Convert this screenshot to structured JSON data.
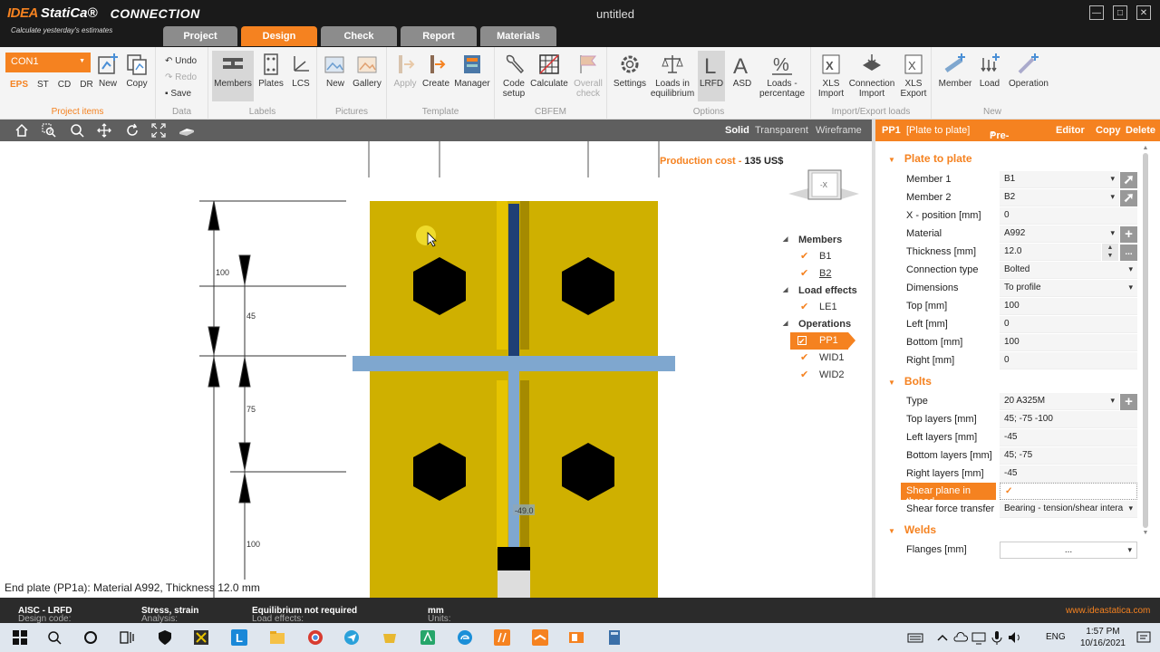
{
  "app": {
    "brand_idea": "IDEA",
    "brand_statica": "StatiCa®",
    "product": "CONNECTION",
    "tagline": "Calculate yesterday's estimates",
    "window_title": "untitled",
    "minimize": "—",
    "maximize": "□",
    "close": "✕"
  },
  "tabs": [
    {
      "label": "Project"
    },
    {
      "label": "Design"
    },
    {
      "label": "Check"
    },
    {
      "label": "Report"
    },
    {
      "label": "Materials"
    }
  ],
  "ribbon": {
    "connection_select": "CON1",
    "codes": [
      "EPS",
      "ST",
      "CD",
      "DR"
    ],
    "new_label": "New",
    "copy_label": "Copy",
    "project_items_label": "Project items",
    "undo": "Undo",
    "redo": "Redo",
    "save": "Save",
    "data_label": "Data",
    "members": "Members",
    "plates": "Plates",
    "lcs": "LCS",
    "labels_label": "Labels",
    "pic_new": "New",
    "gallery": "Gallery",
    "pictures_label": "Pictures",
    "apply": "Apply",
    "create": "Create",
    "manager": "Manager",
    "template_label": "Template",
    "code_setup": "Code\nsetup",
    "calculate": "Calculate",
    "overall_check": "Overall\ncheck",
    "cbfem_label": "CBFEM",
    "settings": "Settings",
    "loads_eq": "Loads in\nequilibrium",
    "lrfd": "LRFD",
    "asd": "ASD",
    "loads_pct": "Loads -\npercentage",
    "options_label": "Options",
    "xls_import": "XLS\nImport",
    "conn_import": "Connection\nImport",
    "xls_export": "XLS\nExport",
    "ie_label": "Import/Export loads",
    "member": "Member",
    "load": "Load",
    "operation": "Operation",
    "new_group_label": "New"
  },
  "toolbar": {
    "solid": "Solid",
    "transparent": "Transparent",
    "wireframe": "Wireframe"
  },
  "viewport": {
    "production_cost_label": "Production cost",
    "production_cost_sep": "-",
    "production_cost_value": "135 US$",
    "cube_label": "-X",
    "dims": [
      "100",
      "45",
      "75",
      "100"
    ],
    "weld_tag": "-49.0",
    "status": "End plate (PP1a): Material A992, Thickness 12.0 mm"
  },
  "tree": {
    "members_label": "Members",
    "members": [
      "B1",
      "B2"
    ],
    "loads_label": "Load effects",
    "loads": [
      "LE1"
    ],
    "ops_label": "Operations",
    "ops": [
      "PP1",
      "WID1",
      "WID2"
    ]
  },
  "panel_header": {
    "id": "PP1",
    "name": "[Plate to plate]",
    "predesign": "Pre-design",
    "editor": "Editor",
    "copy": "Copy",
    "delete": "Delete"
  },
  "props": {
    "sec_plate": "Plate to plate",
    "member1_label": "Member 1",
    "member1": "B1",
    "member2_label": "Member 2",
    "member2": "B2",
    "xpos_label": "X - position [mm]",
    "xpos": "0",
    "material_label": "Material",
    "material": "A992",
    "thickness_label": "Thickness [mm]",
    "thickness": "12.0",
    "conntype_label": "Connection type",
    "conntype": "Bolted",
    "dimensions_label": "Dimensions",
    "dimensions": "To profile",
    "top_label": "Top [mm]",
    "top": "100",
    "left_label": "Left [mm]",
    "left": "0",
    "bottom_label": "Bottom [mm]",
    "bottom": "100",
    "right_label": "Right [mm]",
    "right": "0",
    "sec_bolts": "Bolts",
    "type_label": "Type",
    "type": "20 A325M",
    "toplayers_label": "Top layers [mm]",
    "toplayers": "45; -75 -100",
    "leftlayers_label": "Left layers [mm]",
    "leftlayers": "-45",
    "bottomlayers_label": "Bottom layers [mm]",
    "bottomlayers": "45; -75",
    "rightlayers_label": "Right layers [mm]",
    "rightlayers": "-45",
    "shear_label": "Shear plane in thread",
    "shear_check": "✓",
    "sft_label": "Shear force transfer",
    "sft": "Bearing - tension/shear intera",
    "sec_welds": "Welds",
    "flanges_label": "Flanges [mm]",
    "flanges": "..."
  },
  "bottombar": {
    "dc_label": "Design code:",
    "dc": "AISC - LRFD",
    "an_label": "Analysis:",
    "an": "Stress, strain",
    "le_label": "Load effects:",
    "le": "Equilibrium not required",
    "un_label": "Units:",
    "un": "mm",
    "url": "www.ideastatica.com"
  },
  "taskbar": {
    "lang": "ENG",
    "time": "1:57 PM",
    "date": "10/16/2021"
  },
  "colors": {
    "accent": "#f58220",
    "plate": "#cfb000",
    "beam": "#7fa7cf"
  }
}
